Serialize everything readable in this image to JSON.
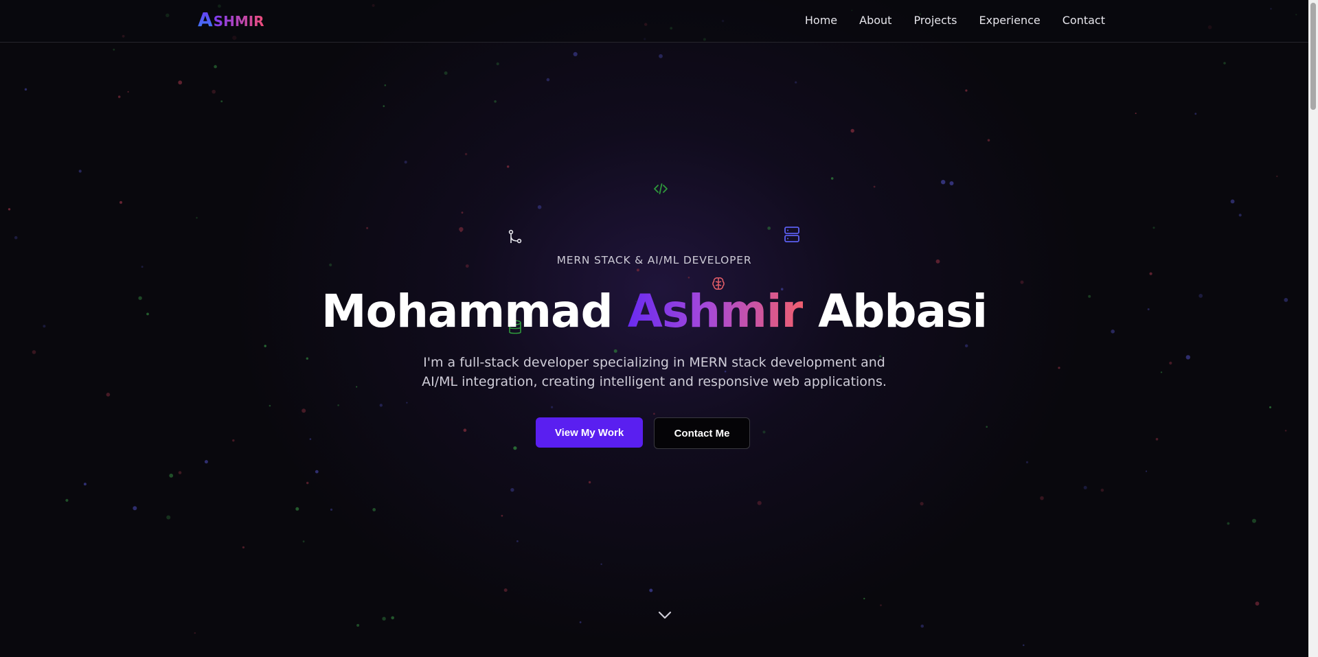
{
  "nav": {
    "logo_mark": "A",
    "logo_text": "SHMIR",
    "links": [
      "Home",
      "About",
      "Projects",
      "Experience",
      "Contact"
    ]
  },
  "hero": {
    "subtitle": "MERN STACK & AI/ML DEVELOPER",
    "name_first": "Mohammad",
    "name_accent": "Ashmir",
    "name_last": "Abbasi",
    "description_line1": "I'm a full-stack developer specializing in MERN stack development and",
    "description_line2": "AI/ML integration, creating intelligent and responsive web applications.",
    "primary_button": "View My Work",
    "secondary_button": "Contact Me"
  },
  "colors": {
    "background": "#09080d",
    "accent_purple": "#5a1ff0",
    "gradient_start": "#6a2bf0",
    "gradient_end": "#ef5f6f",
    "dot_green": "#2e7a3a",
    "dot_blue": "#3a3a8a",
    "dot_red": "#7a2a3a"
  },
  "icons": [
    "code-icon",
    "git-branch-icon",
    "server-icon",
    "brain-icon",
    "database-icon",
    "chevron-down-icon"
  ]
}
